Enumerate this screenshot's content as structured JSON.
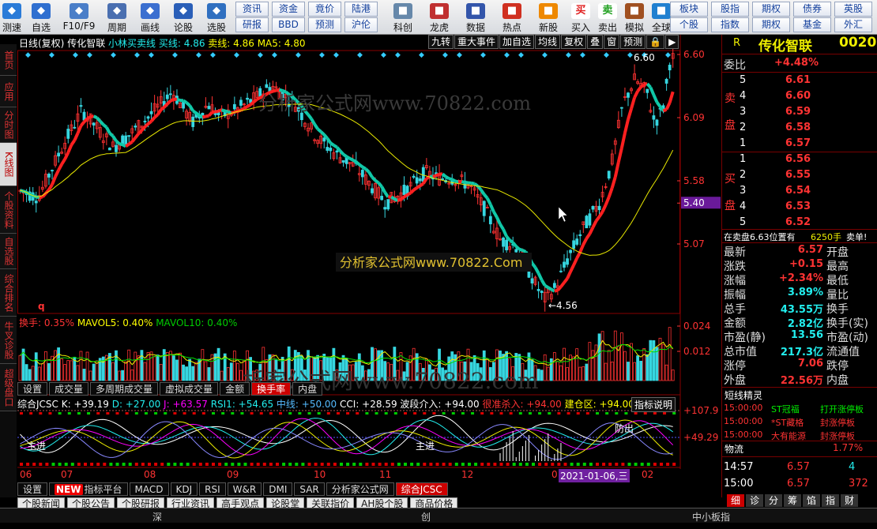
{
  "toolbar": {
    "buttons": [
      {
        "label": "测速",
        "icon": "speed-icon"
      },
      {
        "label": "自选",
        "icon": "star-icon"
      },
      {
        "label": "F10/F9",
        "icon": "f10-icon"
      },
      {
        "label": "周期",
        "icon": "clock-icon"
      },
      {
        "label": "画线",
        "icon": "pencil-icon"
      },
      {
        "label": "论股",
        "icon": "forum-icon"
      },
      {
        "label": "选股",
        "icon": "screen-icon"
      }
    ],
    "tags": [
      {
        "top": "资讯",
        "bottom": "研报"
      },
      {
        "top": "资金",
        "bottom": "BBD"
      },
      {
        "top": "竟价",
        "bottom": "预测"
      },
      {
        "top": "陆港",
        "bottom": "沪伦"
      }
    ],
    "buttons2": [
      {
        "label": "科创",
        "icon": "star-market-icon"
      },
      {
        "label": "龙虎",
        "icon": "dragon-icon"
      },
      {
        "label": "数据",
        "icon": "pe-icon"
      },
      {
        "label": "热点",
        "icon": "hot-icon"
      },
      {
        "label": "新股",
        "icon": "ipo-icon"
      },
      {
        "label": "买入",
        "icon": "buy-icon",
        "glyph": "买"
      },
      {
        "label": "卖出",
        "icon": "sell-icon",
        "glyph": "卖"
      },
      {
        "label": "模拟",
        "icon": "hammer-icon"
      },
      {
        "label": "全球",
        "icon": "globe-icon"
      }
    ],
    "tags2": [
      {
        "top": "板块",
        "bottom": "个股"
      },
      {
        "top": "股指",
        "bottom": "指数"
      },
      {
        "top": "期权",
        "bottom": "期权"
      },
      {
        "top": "债券",
        "bottom": "基金"
      },
      {
        "top": "英股",
        "bottom": "外汇"
      }
    ]
  },
  "leftbar": [
    "首页",
    "应用",
    "分时图",
    "K线图",
    "个股资料",
    "自选股",
    "综合排名",
    "牛叉诊股",
    "超级盘口"
  ],
  "chart": {
    "header": {
      "period": "日线(复权)",
      "name": "传化智联",
      "formula": "小林买卖线",
      "buy": "买线: 4.86",
      "sell": "卖线: 4.86",
      "ma5": "MA5: 4.80"
    },
    "buttons": [
      "九转",
      "重大事件",
      "加自选",
      "均线",
      "复权",
      "叠",
      "窗",
      "预测"
    ],
    "price_labels": [
      "6.60",
      "6.09",
      "5.58",
      "5.40",
      "5.07"
    ],
    "high_label": "6.60",
    "low_label": "4.56",
    "q": "q",
    "vol_header": {
      "a": "换手: 0.35%",
      "b": "MAVOL5: 0.40%",
      "c": "MAVOL10: 0.40%"
    },
    "vol_labels": [
      "0.024",
      "0.012"
    ],
    "vol_tabs": [
      "设置",
      "成交量",
      "多周期成交量",
      "虚拟成交量",
      "金额",
      "换手率",
      "内盘"
    ],
    "jcsc": {
      "a": "综合JCSC K: +39.19",
      "b": "D: +27.00",
      "c": "J: +63.57",
      "d": "RSI1: +54.65",
      "e": "中线: +50.00",
      "f": "CCI: +28.59",
      "g": "波段介入: +94.00",
      "h": "很准杀入: +94.00",
      "i": "建仓区: +94.00",
      "desc": "指标说明"
    },
    "jcsc_labels": [
      "+107.9",
      "+49.29"
    ],
    "texts": {
      "zj1": "主进",
      "zj2": "主进",
      "zc": "防出"
    },
    "xaxis": [
      "06",
      "07",
      "08",
      "09",
      "10",
      "11",
      "12",
      "0"
    ],
    "xaxis_last": "02",
    "date_box": "2021-01-06,三",
    "bottom_tabs": [
      "设置",
      "指标平台",
      "MACD",
      "KDJ",
      "RSI",
      "W&R",
      "DMI",
      "SAR",
      "分析家公式网",
      "综合JCSC"
    ],
    "new_badge": "NEW",
    "watermark1": "分析家公式网www.70822.com",
    "watermark2": "分析家公式网www.70822.Com",
    "watermark3": "析家公式网www.70822.com"
  },
  "right": {
    "code_prefix": "R",
    "name": "传化智联",
    "code": "0020",
    "weibi": "委比",
    "weibi_val": "+4.48%",
    "sell": [
      [
        "5",
        "6.61"
      ],
      [
        "4",
        "6.60"
      ],
      [
        "3",
        "6.59"
      ],
      [
        "2",
        "6.58"
      ],
      [
        "1",
        "6.57"
      ]
    ],
    "buy": [
      [
        "1",
        "6.56"
      ],
      [
        "2",
        "6.55"
      ],
      [
        "3",
        "6.54"
      ],
      [
        "4",
        "6.53"
      ],
      [
        "5",
        "6.52"
      ]
    ],
    "sell_label": "卖盘",
    "buy_label": "买盘",
    "notice": "在卖盘6.63位置有",
    "notice_qty": "6250手",
    "notice_tail": "卖单!",
    "quote": [
      [
        "最新",
        "6.57",
        "开盘",
        ""
      ],
      [
        "涨跌",
        "+0.15",
        "最高",
        ""
      ],
      [
        "涨幅",
        "+2.34%",
        "最低",
        ""
      ],
      [
        "振幅",
        "3.89%",
        "量比",
        ""
      ],
      [
        "总手",
        "43.55万",
        "换手",
        ""
      ],
      [
        "金额",
        "2.82亿",
        "换手(实)",
        ""
      ],
      [
        "市盈(静)",
        "13.56",
        "市盈(动)",
        ""
      ],
      [
        "总市值",
        "217.3亿",
        "流通值",
        ""
      ],
      [
        "涨停",
        "7.06",
        "跌停",
        ""
      ],
      [
        "外盘",
        "22.56万",
        "内盘",
        ""
      ]
    ],
    "short_title": "短线精灵",
    "short": [
      [
        "15:00:00",
        "ST冠福",
        "打开涨停板"
      ],
      [
        "15:00:00",
        "*ST藏格",
        "封涨停板"
      ],
      [
        "15:00:00",
        "大有能源",
        "封涨停板"
      ]
    ],
    "flow": "物流",
    "flow_val": "1.77%",
    "ticks": [
      [
        "14:57",
        "6.57",
        "4"
      ],
      [
        "15:00",
        "6.57",
        "372"
      ]
    ]
  },
  "bottom": {
    "subtabs": [
      "个股新闻",
      "个股公告",
      "个股研报",
      "行业资讯",
      "高手观点",
      "论股堂",
      "关联指价",
      "AH股个股",
      "商品价格"
    ],
    "status": [
      "深",
      "创",
      "中小板指"
    ],
    "rtabs": [
      "细",
      "诊",
      "分",
      "筹",
      "馅",
      "指",
      "财"
    ]
  },
  "colors": {
    "up": "#ff3232",
    "down": "#36d6e0",
    "ma_fast_up": "#ff2020",
    "ma_fast_down": "#10c8a8",
    "ma_slow": "#e8e800"
  }
}
